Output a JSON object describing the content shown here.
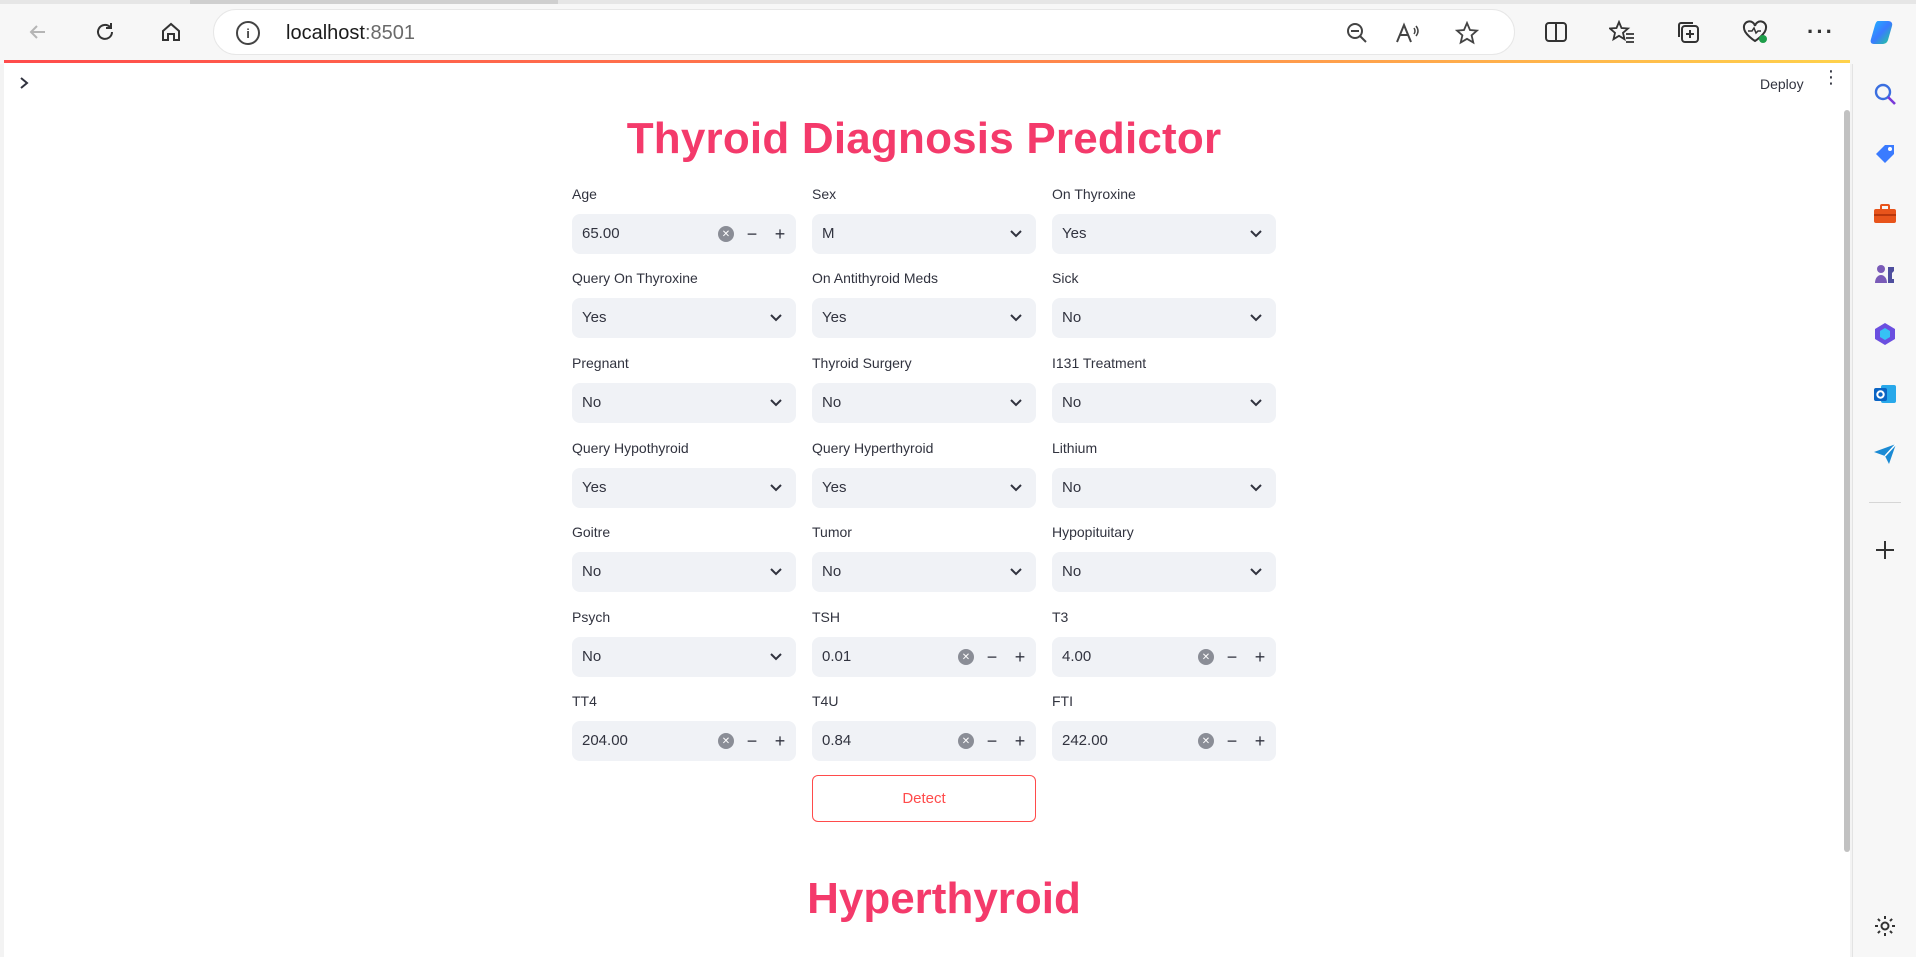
{
  "browser": {
    "url_host": "localhost",
    "url_port": ":8501",
    "icons": [
      "back-icon",
      "refresh-icon",
      "home-icon",
      "info-icon",
      "zoom-out-icon",
      "read-aloud-icon",
      "favorite-star-icon",
      "split-screen-icon",
      "favorites-icon",
      "collections-icon",
      "browser-essentials-icon",
      "more-icon",
      "copilot-icon"
    ]
  },
  "app": {
    "deploy_label": "Deploy",
    "title": "Thyroid Diagnosis Predictor",
    "fields": [
      {
        "label": "Age",
        "type": "number",
        "value": "65.00"
      },
      {
        "label": "Sex",
        "type": "select",
        "value": "M"
      },
      {
        "label": "On Thyroxine",
        "type": "select",
        "value": "Yes"
      },
      {
        "label": "Query On Thyroxine",
        "type": "select",
        "value": "Yes"
      },
      {
        "label": "On Antithyroid Meds",
        "type": "select",
        "value": "Yes"
      },
      {
        "label": "Sick",
        "type": "select",
        "value": "No"
      },
      {
        "label": "Pregnant",
        "type": "select",
        "value": "No"
      },
      {
        "label": "Thyroid Surgery",
        "type": "select",
        "value": "No"
      },
      {
        "label": "I131 Treatment",
        "type": "select",
        "value": "No"
      },
      {
        "label": "Query Hypothyroid",
        "type": "select",
        "value": "Yes"
      },
      {
        "label": "Query Hyperthyroid",
        "type": "select",
        "value": "Yes"
      },
      {
        "label": "Lithium",
        "type": "select",
        "value": "No"
      },
      {
        "label": "Goitre",
        "type": "select",
        "value": "No"
      },
      {
        "label": "Tumor",
        "type": "select",
        "value": "No"
      },
      {
        "label": "Hypopituitary",
        "type": "select",
        "value": "No"
      },
      {
        "label": "Psych",
        "type": "select",
        "value": "No"
      },
      {
        "label": "TSH",
        "type": "number",
        "value": "0.01"
      },
      {
        "label": "T3",
        "type": "number",
        "value": "4.00"
      },
      {
        "label": "TT4",
        "type": "number",
        "value": "204.00"
      },
      {
        "label": "T4U",
        "type": "number",
        "value": "0.84"
      },
      {
        "label": "FTI",
        "type": "number",
        "value": "242.00"
      }
    ],
    "detect_label": "Detect",
    "result": "Hyperthyroid",
    "accent_color": "#f43a6b",
    "button_color": "#ff4b4b"
  },
  "edge_sidebar": {
    "icons": [
      "search-icon",
      "shopping-tag-icon",
      "tools-icon",
      "games-icon",
      "microsoft-365-icon",
      "outlook-icon",
      "send-icon",
      "add-icon",
      "settings-icon"
    ]
  }
}
